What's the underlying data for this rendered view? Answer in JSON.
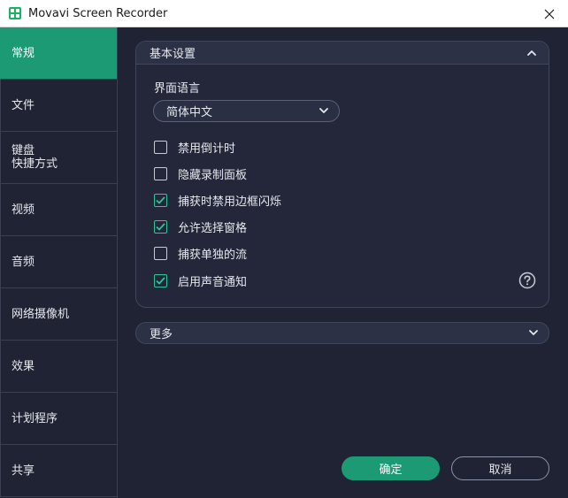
{
  "window": {
    "title": "Movavi Screen Recorder"
  },
  "sidebar": {
    "items": [
      {
        "label": "常规",
        "active": true
      },
      {
        "label": "文件",
        "active": false
      },
      {
        "label": "键盘\n快捷方式",
        "active": false
      },
      {
        "label": "视频",
        "active": false
      },
      {
        "label": "音频",
        "active": false
      },
      {
        "label": "网络摄像机",
        "active": false
      },
      {
        "label": "效果",
        "active": false
      },
      {
        "label": "计划程序",
        "active": false
      },
      {
        "label": "共享",
        "active": false
      }
    ]
  },
  "basic": {
    "title": "基本设置",
    "language_label": "界面语言",
    "language_value": "简体中文",
    "options": [
      {
        "label": "禁用倒计时",
        "checked": false
      },
      {
        "label": "隐藏录制面板",
        "checked": false
      },
      {
        "label": "捕获时禁用边框闪烁",
        "checked": true
      },
      {
        "label": "允许选择窗格",
        "checked": true
      },
      {
        "label": "捕获单独的流",
        "checked": false
      },
      {
        "label": "启用声音通知",
        "checked": true
      }
    ]
  },
  "more": {
    "title": "更多"
  },
  "footer": {
    "ok_label": "确定",
    "cancel_label": "取消"
  },
  "colors": {
    "accent": "#1c9a74",
    "checkbox": "#2fc59a",
    "background": "#1f2333"
  }
}
